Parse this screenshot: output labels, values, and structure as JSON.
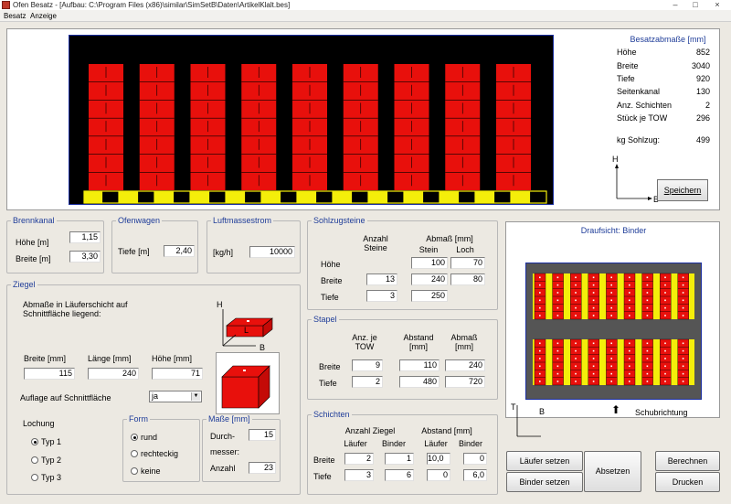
{
  "window": {
    "title": "Ofen Besatz - [Aufbau: C:\\Program Files (x86)\\similar\\SimSetB\\Daten\\ArtikelKlalt.bes]",
    "minimize": "–",
    "maximize": "□",
    "close": "×"
  },
  "menu": {
    "besatz": "Besatz",
    "anzeige": "Anzeige"
  },
  "besatzabmasse": {
    "title": "Besatzabmaße [mm]",
    "rows": [
      {
        "label": "Höhe",
        "value": "852"
      },
      {
        "label": "Breite",
        "value": "3040"
      },
      {
        "label": "Tiefe",
        "value": "920"
      },
      {
        "label": "Seitenkanal",
        "value": "130"
      },
      {
        "label": "Anz. Schichten",
        "value": "2"
      },
      {
        "label": "Stück je TOW",
        "value": "296"
      }
    ],
    "sohlzug_label": "kg Sohlzug:",
    "sohlzug_value": "499",
    "axis_h": "H",
    "axis_b": "B",
    "save_button": "Speichern"
  },
  "brennkanal": {
    "title": "Brennkanal",
    "hoehe_label": "Höhe [m]",
    "hoehe_value": "1,15",
    "breite_label": "Breite [m]",
    "breite_value": "3,30"
  },
  "ofenwagen": {
    "title": "Ofenwagen",
    "tiefe_label": "Tiefe [m]",
    "tiefe_value": "2,40"
  },
  "luftmassestrom": {
    "title": "Luftmassestrom",
    "unit_label": "[kg/h]",
    "value": "10000"
  },
  "ziegel": {
    "title": "Ziegel",
    "desc_line1": "Abmaße in Läuferschicht auf",
    "desc_line2": "Schnittfläche liegend:",
    "axis_h": "H",
    "axis_l": "L",
    "axis_b": "B",
    "breite_label": "Breite [mm]",
    "breite_value": "115",
    "laenge_label": "Länge [mm]",
    "laenge_value": "240",
    "hoehe_label": "Höhe [mm]",
    "hoehe_value": "71",
    "auflage_label": "Auflage auf Schnittfläche",
    "auflage_value": "ja",
    "lochung_label": "Lochung",
    "typ_options": [
      "Typ 1",
      "Typ 2",
      "Typ 3"
    ],
    "form_title": "Form",
    "form_options": [
      "rund",
      "rechteckig",
      "keine"
    ],
    "masse_title": "Maße [mm]",
    "durchmesser_label_1": "Durch-",
    "durchmesser_label_2": "messer:",
    "durchmesser_value": "15",
    "anzahl_label": "Anzahl",
    "anzahl_value": "23"
  },
  "sohlzugsteine": {
    "title": "Sohlzugsteine",
    "col_anzahl_1": "Anzahl",
    "col_anzahl_2": "Steine",
    "col_abmass": "Abmaß [mm]",
    "col_stein": "Stein",
    "col_loch": "Loch",
    "hoehe_label": "Höhe",
    "hoehe_stein": "100",
    "hoehe_loch": "70",
    "breite_label": "Breite",
    "breite_anzahl": "13",
    "breite_stein": "240",
    "breite_loch": "80",
    "tiefe_label": "Tiefe",
    "tiefe_anzahl": "3",
    "tiefe_stein": "250"
  },
  "stapel": {
    "title": "Stapel",
    "col_anz_1": "Anz. je",
    "col_anz_2": "TOW",
    "col_abstand_1": "Abstand",
    "col_abstand_2": "[mm]",
    "col_abmass_1": "Abmaß",
    "col_abmass_2": "[mm]",
    "breite_label": "Breite",
    "breite_anz": "9",
    "breite_abstand": "110",
    "breite_abmass": "240",
    "tiefe_label": "Tiefe",
    "tiefe_anz": "2",
    "tiefe_abstand": "480",
    "tiefe_abmass": "720"
  },
  "schichten": {
    "title": "Schichten",
    "col_anzahl": "Anzahl Ziegel",
    "col_abstand": "Abstand [mm]",
    "col_laeufer": "Läufer",
    "col_binder": "Binder",
    "breite_label": "Breite",
    "breite_vals": [
      "2",
      "1",
      "10,0",
      "0"
    ],
    "tiefe_label": "Tiefe",
    "tiefe_vals": [
      "3",
      "6",
      "0",
      "6,0"
    ]
  },
  "draufsicht": {
    "title": "Draufsicht: Binder",
    "axis_t": "T",
    "axis_b": "B",
    "schub_label": "Schubrichtung"
  },
  "buttons": {
    "laeufer_setzen": "Läufer setzen",
    "binder_setzen": "Binder setzen",
    "absetzen": "Absetzen",
    "berechnen": "Berechnen",
    "drucken": "Drucken"
  },
  "colors": {
    "brick_red": "#e8100c",
    "kiln_bg": "#000000",
    "kiln_border": "#1a2ea0",
    "sole_yellow": "#f4ee0a",
    "group_title_blue": "#1f3d99"
  }
}
